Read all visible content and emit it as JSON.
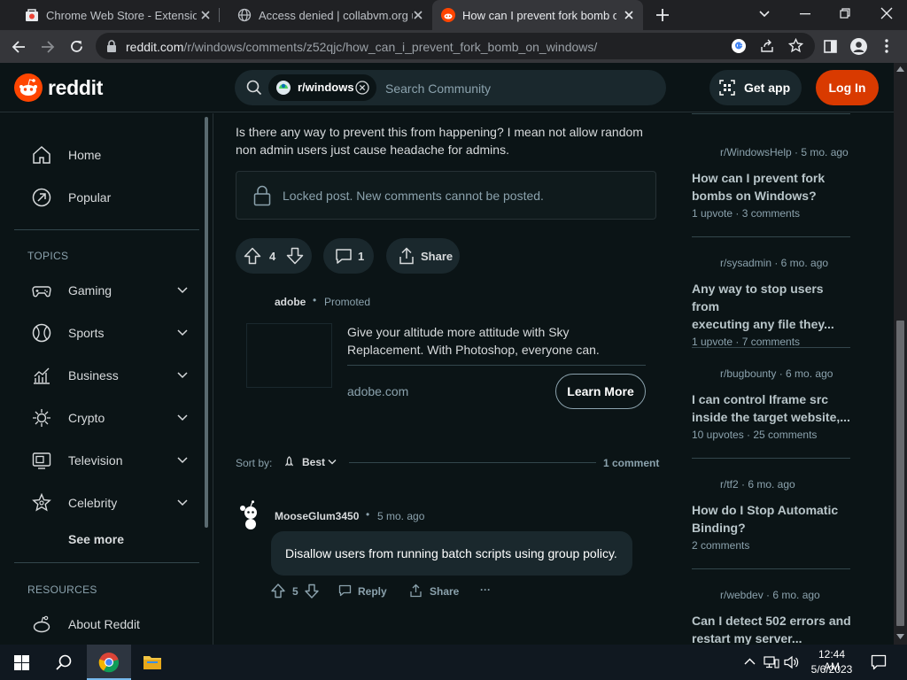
{
  "browser": {
    "tabs": [
      {
        "title": "Chrome Web Store - Extensions"
      },
      {
        "title": "Access denied | collabvm.org use"
      },
      {
        "title": "How can I prevent fork bomb on"
      }
    ],
    "url_host": "reddit.com",
    "url_path": "/r/windows/comments/z52qjc/how_can_i_prevent_fork_bomb_on_windows/"
  },
  "header": {
    "logo": "reddit",
    "community": "r/windows",
    "search_placeholder": "Search Community",
    "get_app": "Get app",
    "login": "Log In"
  },
  "sidebar": {
    "home": "Home",
    "popular": "Popular",
    "topics_header": "TOPICS",
    "topics": [
      "Gaming",
      "Sports",
      "Business",
      "Crypto",
      "Television",
      "Celebrity"
    ],
    "see_more": "See more",
    "resources_header": "RESOURCES",
    "about": "About Reddit"
  },
  "post": {
    "body_line1": "Is there any way to prevent this from happening? I mean not allow random",
    "body_line2": "non admin users just cause headache for admins.",
    "locked_text": "Locked post. New comments cannot be posted.",
    "votes": "4",
    "comments": "1",
    "share": "Share"
  },
  "ad": {
    "advertiser": "adobe",
    "promoted": "Promoted",
    "text_line1": "Give your altitude more attitude with Sky",
    "text_line2": "Replacement. With Photoshop, everyone can.",
    "domain": "adobe.com",
    "cta": "Learn More"
  },
  "comments_section": {
    "sort_label": "Sort by:",
    "sort_value": "Best",
    "count": "1 comment",
    "comment": {
      "author": "MooseGlum3450",
      "time": "5 mo. ago",
      "text": "Disallow users from running batch scripts using group policy.",
      "votes": "5",
      "reply": "Reply",
      "share": "Share",
      "more": "···"
    }
  },
  "related": [
    {
      "sub": "r/WindowsHelp · 5 mo. ago",
      "title_l1": "How can I prevent fork",
      "title_l2": "bombs on Windows?",
      "meta": "1 upvote  ·  3 comments"
    },
    {
      "sub": "r/sysadmin · 6 mo. ago",
      "title_l1": "Any way to stop users from",
      "title_l2": "executing any file they...",
      "meta": "1 upvote  ·  7 comments"
    },
    {
      "sub": "r/bugbounty · 6 mo. ago",
      "title_l1": "I can control Iframe src",
      "title_l2": "inside the target website,...",
      "meta": "10 upvotes  ·  25 comments"
    },
    {
      "sub": "r/tf2 · 6 mo. ago",
      "title_l1": "How do I Stop Automatic",
      "title_l2": "Binding?",
      "meta": "2 comments"
    },
    {
      "sub": "r/webdev · 6 mo. ago",
      "title_l1": "Can I detect 502 errors and",
      "title_l2": "restart my server...",
      "meta": ""
    }
  ],
  "taskbar": {
    "time": "12:44 AM",
    "date": "5/6/2023"
  },
  "colors": {
    "reddit_orange": "#ff4500",
    "login_bg": "#d93a00",
    "page_bg": "#0b1416"
  }
}
